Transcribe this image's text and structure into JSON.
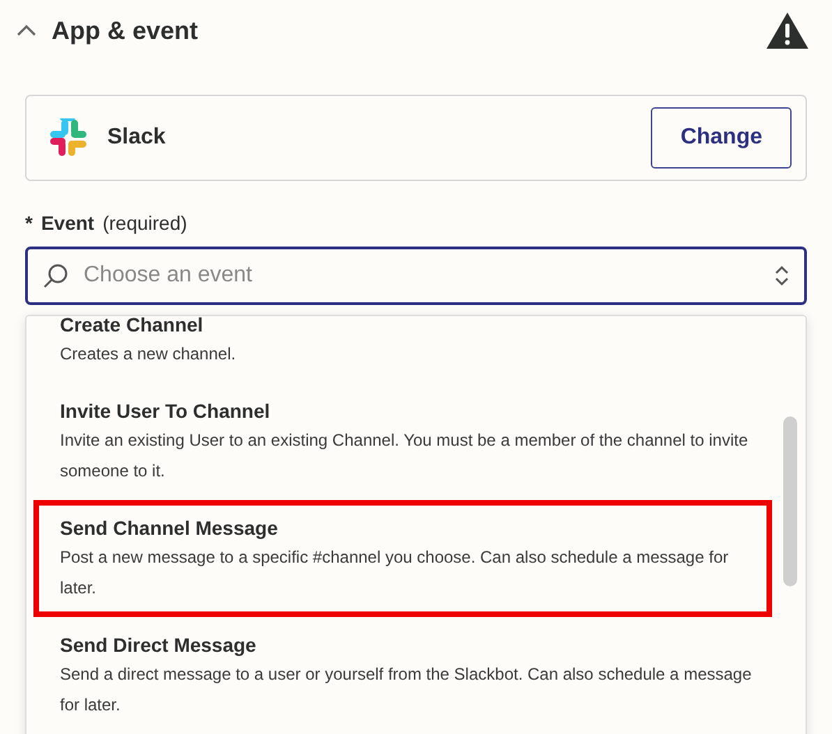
{
  "section": {
    "title": "App & event",
    "expanded": true,
    "warning": true
  },
  "app": {
    "name": "Slack",
    "button": "Change"
  },
  "event": {
    "required_mark": "*",
    "label": "Event",
    "hint": "(required)",
    "placeholder": "Choose an event"
  },
  "options": [
    {
      "title": "Create Channel",
      "description": "Creates a new channel.",
      "highlighted": false
    },
    {
      "title": "Invite User To Channel",
      "description": "Invite an existing User to an existing Channel. You must be a member of the channel to invite someone to it.",
      "highlighted": false
    },
    {
      "title": "Send Channel Message",
      "description": "Post a new message to a specific #channel you choose. Can also schedule a message for later.",
      "highlighted": true
    },
    {
      "title": "Send Direct Message",
      "description": "Send a direct message to a user or yourself from the Slackbot. Can also schedule a message for later.",
      "highlighted": false
    }
  ]
}
